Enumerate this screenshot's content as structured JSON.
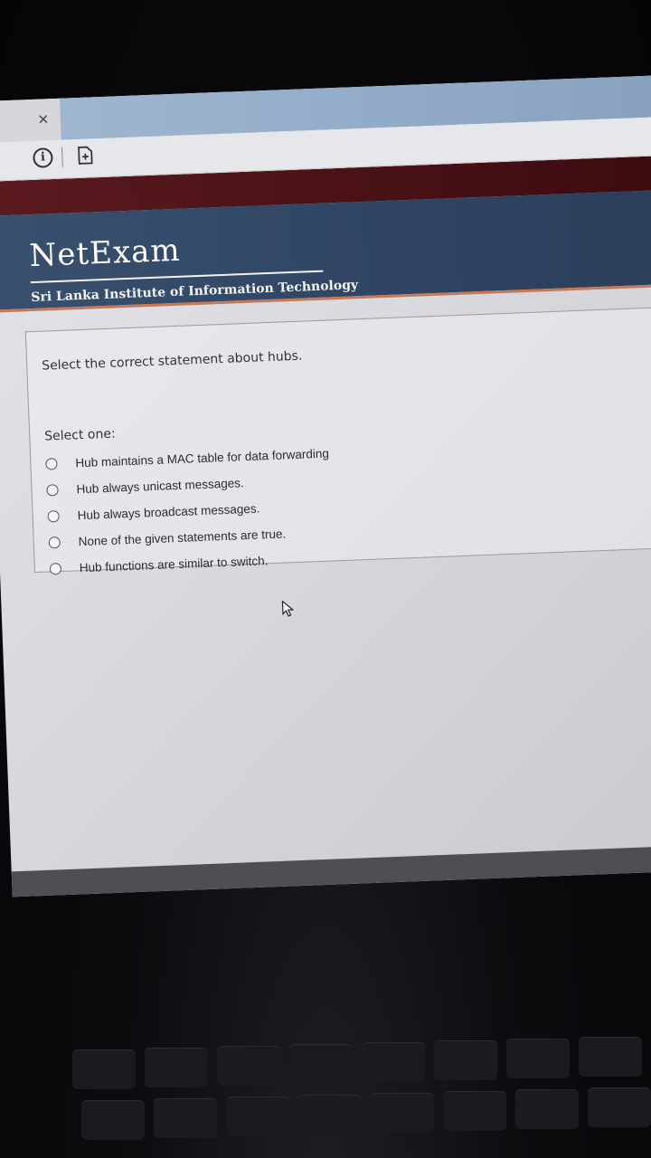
{
  "browser": {
    "tab_close_glyph": "×",
    "info_icon": "info-icon",
    "page_icon": "page-plus-icon"
  },
  "header": {
    "brand": "NetExam",
    "institute": "Sri Lanka Institute of Information Technology"
  },
  "question": {
    "text": "Select the correct statement about hubs.",
    "select_prompt": "Select one:",
    "options": [
      {
        "label": "Hub maintains a MAC table for data forwarding"
      },
      {
        "label": "Hub always unicast messages."
      },
      {
        "label": "Hub always broadcast messages."
      },
      {
        "label": "None of the given statements are true."
      },
      {
        "label": "Hub functions are similar to switch."
      }
    ]
  },
  "colors": {
    "banner": "#2f4563",
    "bookmark_bar": "#4a1217",
    "tab_active": "#8fa9c6",
    "accent_line": "#c47a57"
  }
}
